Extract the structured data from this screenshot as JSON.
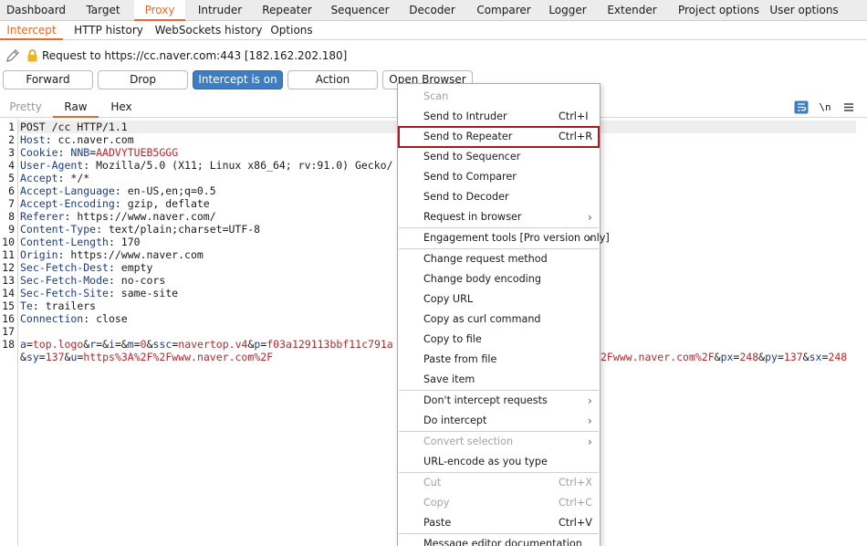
{
  "top_tabs": [
    {
      "label": "Dashboard",
      "active": false
    },
    {
      "label": "Target",
      "active": false
    },
    {
      "label": "Proxy",
      "active": true
    },
    {
      "label": "Intruder",
      "active": false
    },
    {
      "label": "Repeater",
      "active": false
    },
    {
      "label": "Sequencer",
      "active": false
    },
    {
      "label": "Decoder",
      "active": false
    },
    {
      "label": "Comparer",
      "active": false
    },
    {
      "label": "Logger",
      "active": false
    },
    {
      "label": "Extender",
      "active": false
    },
    {
      "label": "Project options",
      "active": false
    },
    {
      "label": "User options",
      "active": false
    }
  ],
  "sub_tabs": [
    {
      "label": "Intercept",
      "active": true
    },
    {
      "label": "HTTP history",
      "active": false
    },
    {
      "label": "WebSockets history",
      "active": false
    },
    {
      "label": "Options",
      "active": false
    }
  ],
  "request_info": "Request to https://cc.naver.com:443  [182.162.202.180]",
  "buttons": {
    "forward": "Forward",
    "drop": "Drop",
    "intercept": "Intercept is on",
    "action": "Action",
    "open_browser": "Open Browser"
  },
  "view_tabs": [
    "Pretty",
    "Raw",
    "Hex"
  ],
  "view_active": "Raw",
  "toolbar": {
    "wrap_icon": "wrap-lines-icon",
    "newline_label": "\\n",
    "menu_icon": "hamburger-menu-icon"
  },
  "request_lines": [
    {
      "n": "1",
      "parts": [
        {
          "t": "POST /cc HTTP/1.1",
          "c": "hval"
        }
      ]
    },
    {
      "n": "2",
      "parts": [
        {
          "t": "Host",
          "c": "hname"
        },
        {
          "t": ": cc.naver.com",
          "c": "hval"
        }
      ]
    },
    {
      "n": "3",
      "parts": [
        {
          "t": "Cookie",
          "c": "hname"
        },
        {
          "t": ": ",
          "c": "hval"
        },
        {
          "t": "NNB",
          "c": "navy"
        },
        {
          "t": "=",
          "c": "hval"
        },
        {
          "t": "AADVYTUEB5GGG",
          "c": "red"
        }
      ]
    },
    {
      "n": "4",
      "parts": [
        {
          "t": "User-Agent",
          "c": "hname"
        },
        {
          "t": ": Mozilla/5.0 (X11; Linux x86_64; rv:91.0) Gecko/",
          "c": "hval"
        }
      ]
    },
    {
      "n": "5",
      "parts": [
        {
          "t": "Accept",
          "c": "hname"
        },
        {
          "t": ": */*",
          "c": "hval"
        }
      ]
    },
    {
      "n": "6",
      "parts": [
        {
          "t": "Accept-Language",
          "c": "hname"
        },
        {
          "t": ": en-US,en;q=0.5",
          "c": "hval"
        }
      ]
    },
    {
      "n": "7",
      "parts": [
        {
          "t": "Accept-Encoding",
          "c": "hname"
        },
        {
          "t": ": gzip, deflate",
          "c": "hval"
        }
      ]
    },
    {
      "n": "8",
      "parts": [
        {
          "t": "Referer",
          "c": "hname"
        },
        {
          "t": ": https://www.naver.com/",
          "c": "hval"
        }
      ]
    },
    {
      "n": "9",
      "parts": [
        {
          "t": "Content-Type",
          "c": "hname"
        },
        {
          "t": ": text/plain;charset=UTF-8",
          "c": "hval"
        }
      ]
    },
    {
      "n": "10",
      "parts": [
        {
          "t": "Content-Length",
          "c": "hname"
        },
        {
          "t": ": 170",
          "c": "hval"
        }
      ]
    },
    {
      "n": "11",
      "parts": [
        {
          "t": "Origin",
          "c": "hname"
        },
        {
          "t": ": https://www.naver.com",
          "c": "hval"
        }
      ]
    },
    {
      "n": "12",
      "parts": [
        {
          "t": "Sec-Fetch-Dest",
          "c": "hname"
        },
        {
          "t": ": empty",
          "c": "hval"
        }
      ]
    },
    {
      "n": "13",
      "parts": [
        {
          "t": "Sec-Fetch-Mode",
          "c": "hname"
        },
        {
          "t": ": no-cors",
          "c": "hval"
        }
      ]
    },
    {
      "n": "14",
      "parts": [
        {
          "t": "Sec-Fetch-Site",
          "c": "hname"
        },
        {
          "t": ": same-site",
          "c": "hval"
        }
      ]
    },
    {
      "n": "15",
      "parts": [
        {
          "t": "Te",
          "c": "hname"
        },
        {
          "t": ": trailers",
          "c": "hval"
        }
      ]
    },
    {
      "n": "16",
      "parts": [
        {
          "t": "Connection",
          "c": "hname"
        },
        {
          "t": ": close",
          "c": "hval"
        }
      ]
    },
    {
      "n": "17",
      "parts": []
    },
    {
      "n": "18",
      "parts": [
        {
          "t": "a",
          "c": "navy"
        },
        {
          "t": "=",
          "c": "hval"
        },
        {
          "t": "top.logo",
          "c": "red"
        },
        {
          "t": "&",
          "c": "hval"
        },
        {
          "t": "r",
          "c": "navy"
        },
        {
          "t": "=&",
          "c": "hval"
        },
        {
          "t": "i",
          "c": "navy"
        },
        {
          "t": "=&",
          "c": "hval"
        },
        {
          "t": "m",
          "c": "navy"
        },
        {
          "t": "=",
          "c": "hval"
        },
        {
          "t": "0",
          "c": "red"
        },
        {
          "t": "&",
          "c": "hval"
        },
        {
          "t": "ssc",
          "c": "navy"
        },
        {
          "t": "=",
          "c": "hval"
        },
        {
          "t": "navertop.v4",
          "c": "red"
        },
        {
          "t": "&",
          "c": "hval"
        },
        {
          "t": "p",
          "c": "navy"
        },
        {
          "t": "=",
          "c": "hval"
        },
        {
          "t": "f03a129113bbf11c791a",
          "c": "red"
        }
      ]
    },
    {
      "n": "",
      "parts": [
        {
          "t": "&",
          "c": "hval"
        },
        {
          "t": "sy",
          "c": "navy"
        },
        {
          "t": "=",
          "c": "hval"
        },
        {
          "t": "137",
          "c": "red"
        },
        {
          "t": "&",
          "c": "hval"
        },
        {
          "t": "u",
          "c": "navy"
        },
        {
          "t": "=",
          "c": "hval"
        },
        {
          "t": "https%3A%2F%2Fwww.naver.com%2F",
          "c": "red"
        }
      ]
    }
  ],
  "line18_tail": [
    {
      "t": "2Fwww.naver.com%2F",
      "c": "red"
    },
    {
      "t": "&",
      "c": "hval"
    },
    {
      "t": "px",
      "c": "navy"
    },
    {
      "t": "=",
      "c": "hval"
    },
    {
      "t": "248",
      "c": "red"
    },
    {
      "t": "&",
      "c": "hval"
    },
    {
      "t": "py",
      "c": "navy"
    },
    {
      "t": "=",
      "c": "hval"
    },
    {
      "t": "137",
      "c": "red"
    },
    {
      "t": "&",
      "c": "hval"
    },
    {
      "t": "sx",
      "c": "navy"
    },
    {
      "t": "=",
      "c": "hval"
    },
    {
      "t": "248",
      "c": "red"
    }
  ],
  "context_menu": [
    {
      "label": "Scan",
      "shortcut": "",
      "submenu": false,
      "disabled": true,
      "highlight": false
    },
    {
      "label": "Send to Intruder",
      "shortcut": "Ctrl+I",
      "submenu": false,
      "disabled": false,
      "highlight": false
    },
    {
      "label": "Send to Repeater",
      "shortcut": "Ctrl+R",
      "submenu": false,
      "disabled": false,
      "highlight": true
    },
    {
      "label": "Send to Sequencer",
      "shortcut": "",
      "submenu": false,
      "disabled": false,
      "highlight": false
    },
    {
      "label": "Send to Comparer",
      "shortcut": "",
      "submenu": false,
      "disabled": false,
      "highlight": false
    },
    {
      "label": "Send to Decoder",
      "shortcut": "",
      "submenu": false,
      "disabled": false,
      "highlight": false
    },
    {
      "label": "Request in browser",
      "shortcut": "",
      "submenu": true,
      "disabled": false,
      "highlight": false,
      "sep_after": true
    },
    {
      "label": "Engagement tools [Pro version only]",
      "shortcut": "",
      "submenu": true,
      "disabled": false,
      "highlight": false,
      "sep_after": true
    },
    {
      "label": "Change request method",
      "shortcut": "",
      "submenu": false,
      "disabled": false,
      "highlight": false
    },
    {
      "label": "Change body encoding",
      "shortcut": "",
      "submenu": false,
      "disabled": false,
      "highlight": false
    },
    {
      "label": "Copy URL",
      "shortcut": "",
      "submenu": false,
      "disabled": false,
      "highlight": false
    },
    {
      "label": "Copy as curl command",
      "shortcut": "",
      "submenu": false,
      "disabled": false,
      "highlight": false
    },
    {
      "label": "Copy to file",
      "shortcut": "",
      "submenu": false,
      "disabled": false,
      "highlight": false
    },
    {
      "label": "Paste from file",
      "shortcut": "",
      "submenu": false,
      "disabled": false,
      "highlight": false
    },
    {
      "label": "Save item",
      "shortcut": "",
      "submenu": false,
      "disabled": false,
      "highlight": false,
      "sep_after": true
    },
    {
      "label": "Don't intercept requests",
      "shortcut": "",
      "submenu": true,
      "disabled": false,
      "highlight": false
    },
    {
      "label": "Do intercept",
      "shortcut": "",
      "submenu": true,
      "disabled": false,
      "highlight": false,
      "sep_after": true
    },
    {
      "label": "Convert selection",
      "shortcut": "",
      "submenu": true,
      "disabled": true,
      "highlight": false
    },
    {
      "label": "URL-encode as you type",
      "shortcut": "",
      "submenu": false,
      "disabled": false,
      "highlight": false,
      "sep_after": true
    },
    {
      "label": "Cut",
      "shortcut": "Ctrl+X",
      "submenu": false,
      "disabled": true,
      "highlight": false
    },
    {
      "label": "Copy",
      "shortcut": "Ctrl+C",
      "submenu": false,
      "disabled": true,
      "highlight": false
    },
    {
      "label": "Paste",
      "shortcut": "Ctrl+V",
      "submenu": false,
      "disabled": false,
      "highlight": false,
      "sep_after": true
    },
    {
      "label": "Message editor documentation",
      "shortcut": "",
      "submenu": false,
      "disabled": false,
      "highlight": false
    }
  ],
  "colors": {
    "accent": "#e8692b",
    "primary_button": "#3d7ec2",
    "highlight_border": "#a31c22",
    "header_name": "#1e3a8a",
    "param_value": "#b8262b"
  }
}
